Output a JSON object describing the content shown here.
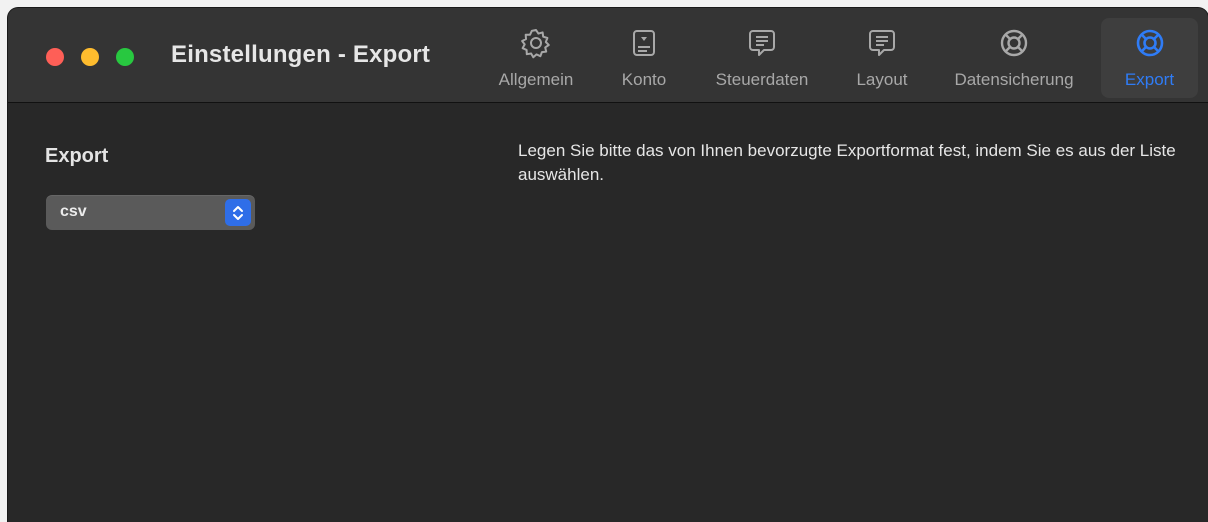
{
  "window": {
    "title": "Einstellungen - Export"
  },
  "toolbar": {
    "items": [
      {
        "label": "Allgemein",
        "icon": "gear-icon"
      },
      {
        "label": "Konto",
        "icon": "account-card-icon"
      },
      {
        "label": "Steuerdaten",
        "icon": "speech-bubble-icon"
      },
      {
        "label": "Layout",
        "icon": "speech-bubble-icon"
      },
      {
        "label": "Datensicherung",
        "icon": "lifebuoy-icon"
      },
      {
        "label": "Export",
        "icon": "lifebuoy-icon",
        "active": true
      }
    ],
    "active_color": "#2f7cf6"
  },
  "main": {
    "section_title": "Export",
    "format_select": {
      "selected": "csv"
    },
    "description": "Legen Sie bitte das von Ihnen bevorzugte Exportformat fest, indem Sie es aus der Liste auswählen."
  }
}
